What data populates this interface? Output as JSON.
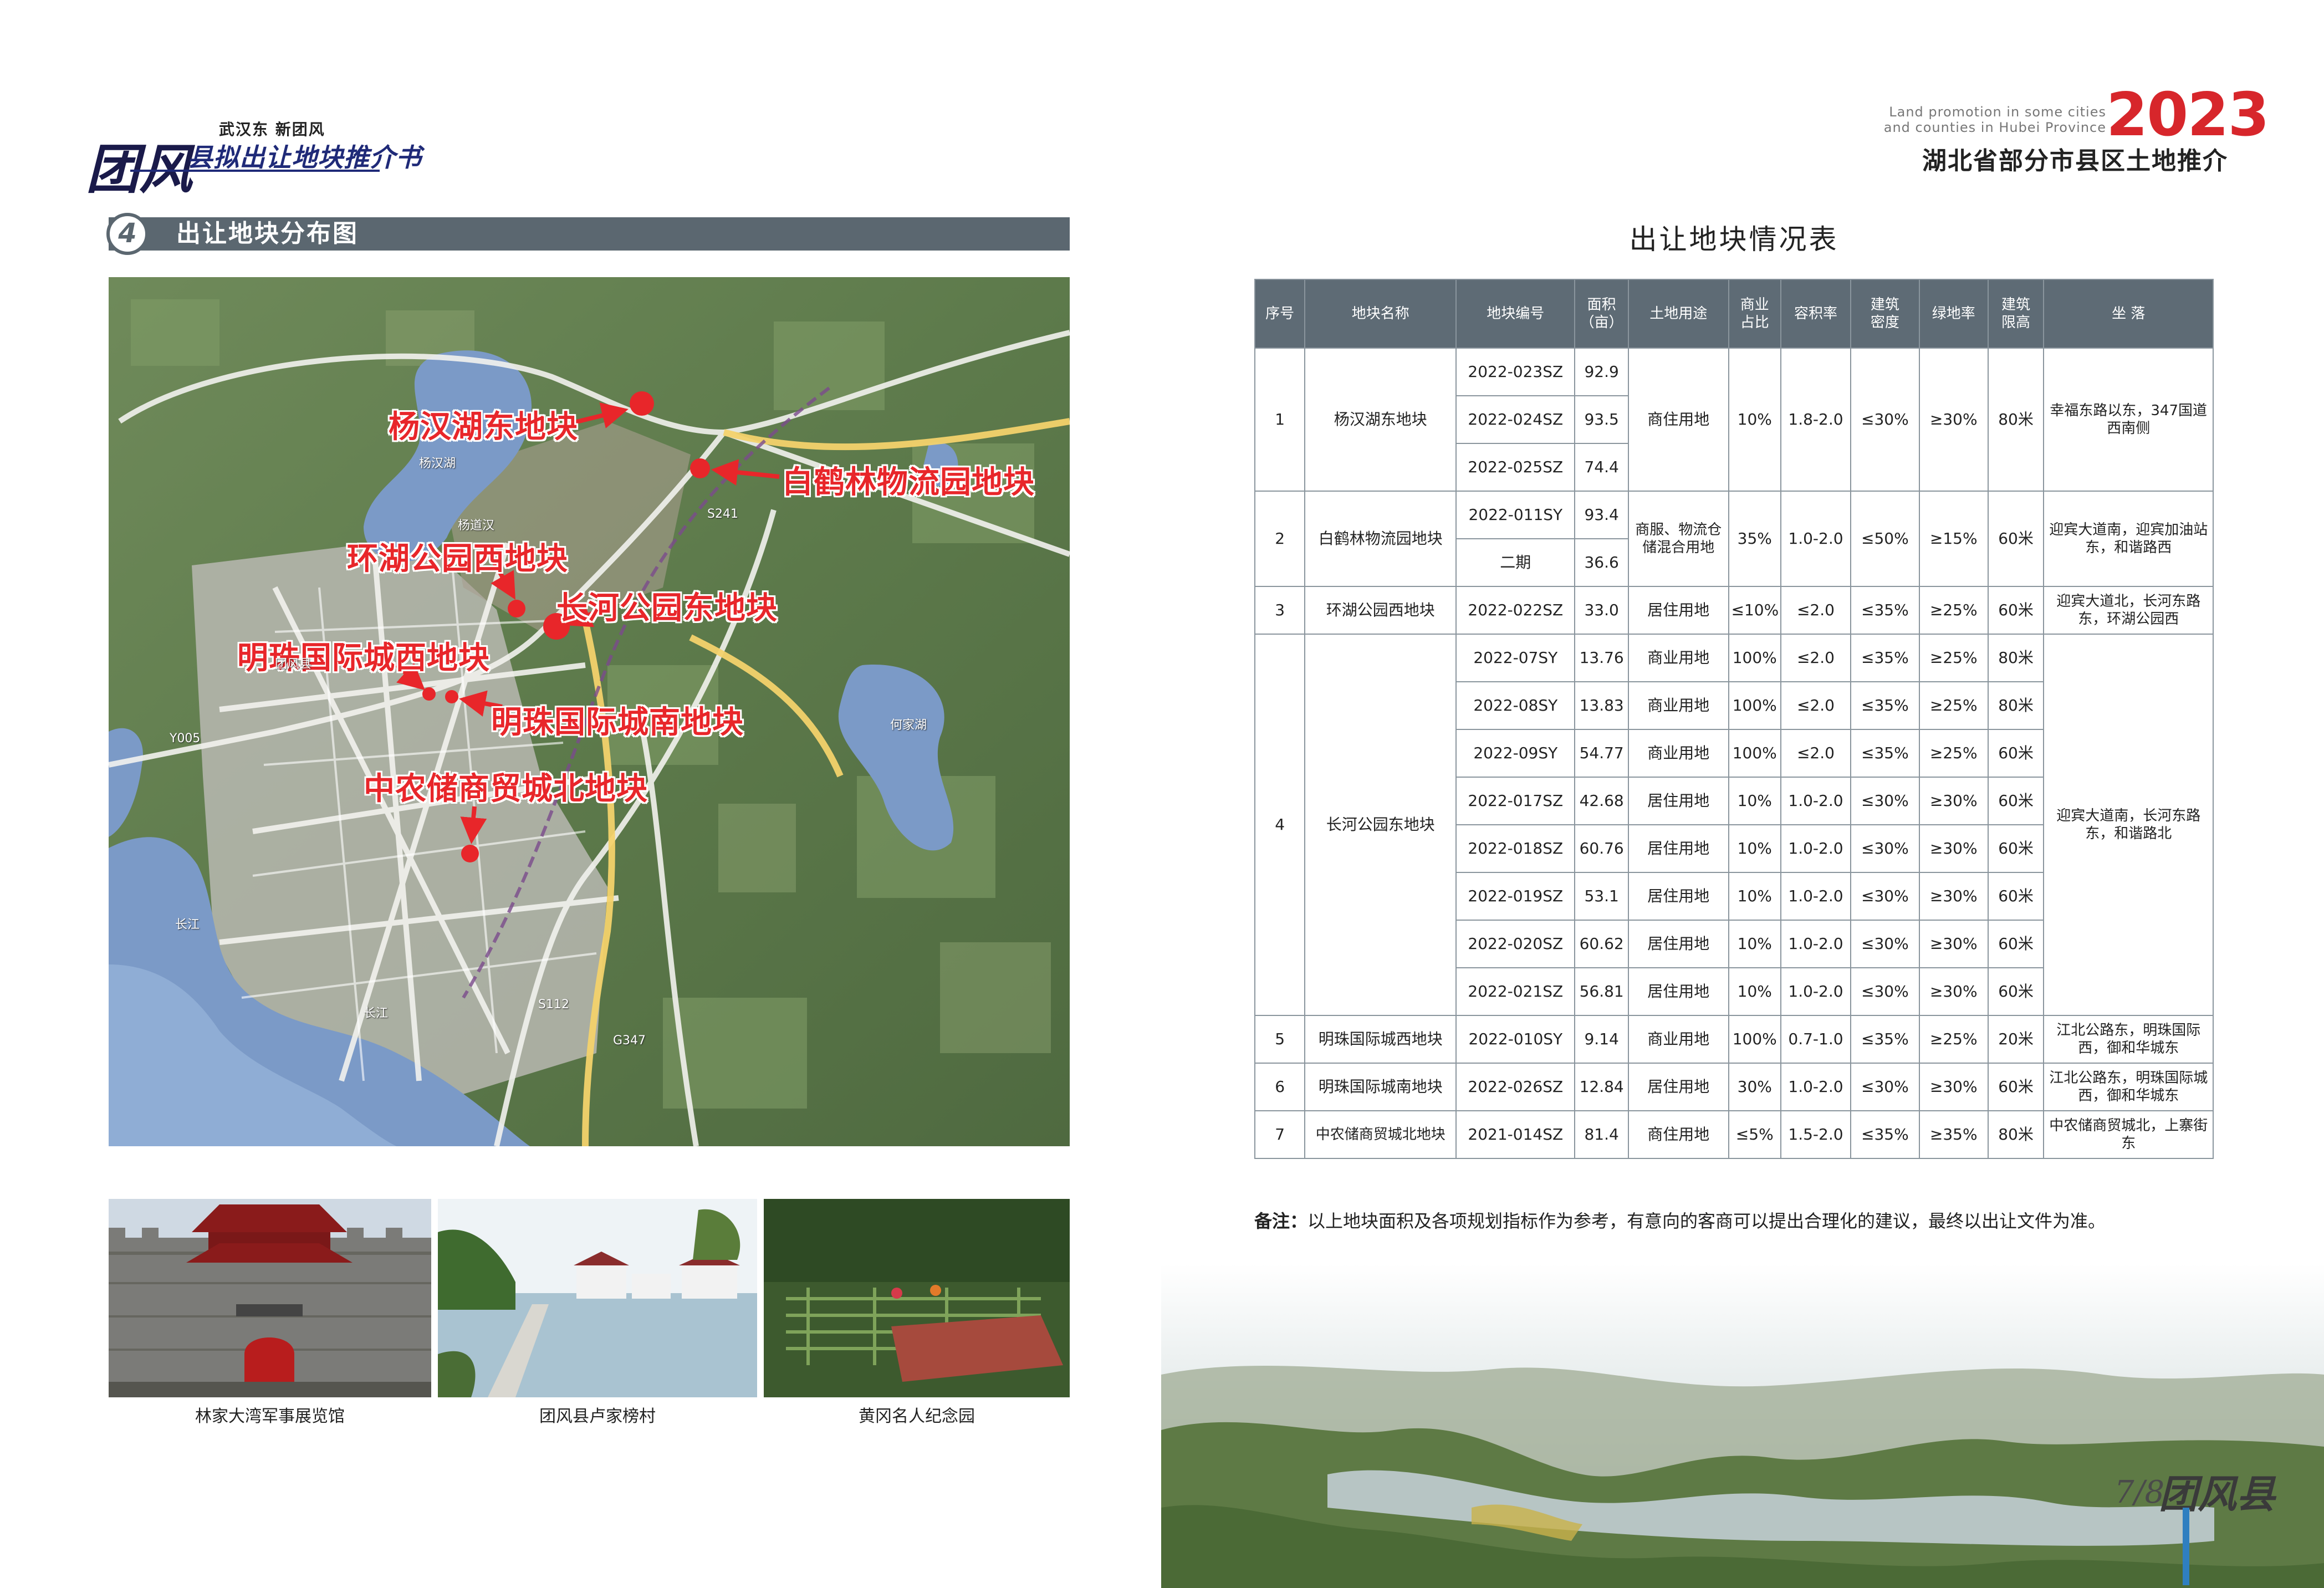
{
  "left_header": {
    "slogan": "武汉东 新团风",
    "logo_text": "团风",
    "title": "县拟出让地块推介书"
  },
  "section": {
    "number": "4",
    "title": "出让地块分布图"
  },
  "map": {
    "parcel_labels": [
      "杨汉湖东地块",
      "白鹤林物流园地块",
      "环湖公园西地块",
      "长河公园东地块",
      "明珠国际城西地块",
      "明珠国际城南地块",
      "中农储商贸城北地块"
    ],
    "place_names": [
      "杨汉湖",
      "何家湖",
      "长江",
      "长江",
      "团风县",
      "杨道汉",
      "Y005",
      "S241",
      "G347",
      "S112"
    ]
  },
  "photos": [
    {
      "caption": "林家大湾军事展览馆"
    },
    {
      "caption": "团风县卢家榜村"
    },
    {
      "caption": "黄冈名人纪念园"
    }
  ],
  "right_header": {
    "en_line1": "Land promotion in some cities",
    "en_line2": "and counties in Hubei Province",
    "year": "2023",
    "title": "湖北省部分市县区土地推介"
  },
  "table": {
    "title": "出让地块情况表",
    "headers": [
      "序号",
      "地块名称",
      "地块编号",
      "面积\n（亩）",
      "土地用途",
      "商业\n占比",
      "容积率",
      "建筑\n密度",
      "绿地率",
      "建筑\n限高",
      "坐  落"
    ],
    "groups": [
      {
        "no": "1",
        "name": "杨汉湖东地块",
        "use": "商住用地",
        "commercial": "10%",
        "far": "1.8-2.0",
        "density": "≤30%",
        "green": "≥30%",
        "height": "80米",
        "location": "幸福东路以东，347国道西南侧",
        "rows": [
          {
            "code": "2022-023SZ",
            "area": "92.9"
          },
          {
            "code": "2022-024SZ",
            "area": "93.5"
          },
          {
            "code": "2022-025SZ",
            "area": "74.4"
          }
        ]
      },
      {
        "no": "2",
        "name": "白鹤林物流园地块",
        "use": "商服、物流仓储混合用地",
        "commercial": "35%",
        "far": "1.0-2.0",
        "density": "≤50%",
        "green": "≥15%",
        "height": "60米",
        "location": "迎宾大道南，迎宾加油站东，和谐路西",
        "rows": [
          {
            "code": "2022-011SY",
            "area": "93.4"
          },
          {
            "code": "二期",
            "area": "36.6"
          }
        ]
      },
      {
        "no": "3",
        "name": "环湖公园西地块",
        "code": "2022-022SZ",
        "area": "33.0",
        "use": "居住用地",
        "commercial": "≤10%",
        "far": "≤2.0",
        "density": "≤35%",
        "green": "≥25%",
        "height": "60米",
        "location": "迎宾大道北，长河东路东，环湖公园西"
      },
      {
        "no": "4",
        "name": "长河公园东地块",
        "location": "迎宾大道南，长河东路东，和谐路北",
        "rows": [
          {
            "code": "2022-07SY",
            "area": "13.76",
            "use": "商业用地",
            "commercial": "100%",
            "far": "≤2.0",
            "density": "≤35%",
            "green": "≥25%",
            "height": "80米"
          },
          {
            "code": "2022-08SY",
            "area": "13.83",
            "use": "商业用地",
            "commercial": "100%",
            "far": "≤2.0",
            "density": "≤35%",
            "green": "≥25%",
            "height": "80米"
          },
          {
            "code": "2022-09SY",
            "area": "54.77",
            "use": "商业用地",
            "commercial": "100%",
            "far": "≤2.0",
            "density": "≤35%",
            "green": "≥25%",
            "height": "60米"
          },
          {
            "code": "2022-017SZ",
            "area": "42.68",
            "use": "居住用地",
            "commercial": "10%",
            "far": "1.0-2.0",
            "density": "≤30%",
            "green": "≥30%",
            "height": "60米"
          },
          {
            "code": "2022-018SZ",
            "area": "60.76",
            "use": "居住用地",
            "commercial": "10%",
            "far": "1.0-2.0",
            "density": "≤30%",
            "green": "≥30%",
            "height": "60米"
          },
          {
            "code": "2022-019SZ",
            "area": "53.1",
            "use": "居住用地",
            "commercial": "10%",
            "far": "1.0-2.0",
            "density": "≤30%",
            "green": "≥30%",
            "height": "60米"
          },
          {
            "code": "2022-020SZ",
            "area": "60.62",
            "use": "居住用地",
            "commercial": "10%",
            "far": "1.0-2.0",
            "density": "≤30%",
            "green": "≥30%",
            "height": "60米"
          },
          {
            "code": "2022-021SZ",
            "area": "56.81",
            "use": "居住用地",
            "commercial": "10%",
            "far": "1.0-2.0",
            "density": "≤30%",
            "green": "≥30%",
            "height": "60米"
          }
        ]
      },
      {
        "no": "5",
        "name": "明珠国际城西地块",
        "code": "2022-010SY",
        "area": "9.14",
        "use": "商业用地",
        "commercial": "100%",
        "far": "0.7-1.0",
        "density": "≤35%",
        "green": "≥25%",
        "height": "20米",
        "location": "江北公路东，明珠国际西，御和华城东"
      },
      {
        "no": "6",
        "name": "明珠国际城南地块",
        "code": "2022-026SZ",
        "area": "12.84",
        "use": "居住用地",
        "commercial": "30%",
        "far": "1.0-2.0",
        "density": "≤30%",
        "green": "≥30%",
        "height": "60米",
        "location": "江北公路东，明珠国际城西，御和华城东"
      },
      {
        "no": "7",
        "name": "中农储商贸城北地块",
        "code": "2021-014SZ",
        "area": "81.4",
        "use": "商住用地",
        "commercial": "≤5%",
        "far": "1.5-2.0",
        "density": "≤35%",
        "green": "≥35%",
        "height": "80米",
        "location": "中农储商贸城北，上寨街东"
      }
    ]
  },
  "note": {
    "label": "备注：",
    "text": "以上地块面积及各项规划指标作为参考，有意向的客商可以提出合理化的建议，最终以出让文件为准。"
  },
  "footer": {
    "page": "7/8",
    "brand": "团风县"
  },
  "colors": {
    "accent_red": "#d7262b",
    "section_bar": "#5b6770",
    "table_header": "#5e6b75",
    "marker_red": "#e8262a"
  }
}
